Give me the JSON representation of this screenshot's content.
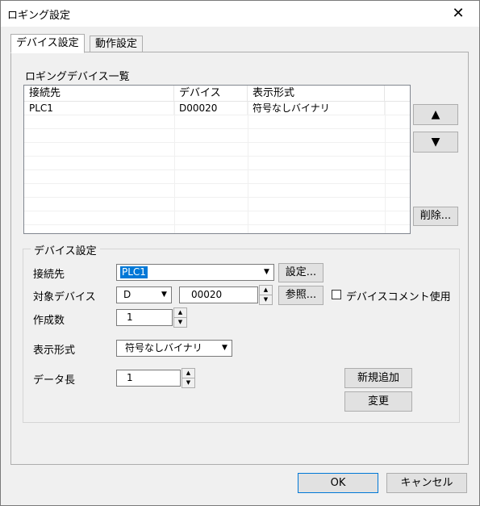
{
  "window": {
    "title": "ロギング設定",
    "close_glyph": "✕"
  },
  "tabs": [
    {
      "label": "デバイス設定",
      "active": true
    },
    {
      "label": "動作設定",
      "active": false
    }
  ],
  "device_list": {
    "title": "ロギングデバイス一覧",
    "columns": [
      "接続先",
      "デバイス",
      "表示形式"
    ],
    "rows": [
      {
        "connection": "PLC1",
        "device": "D00020",
        "format": "符号なしバイナリ"
      }
    ]
  },
  "list_buttons": {
    "up": "▲",
    "down": "▼",
    "delete": "削除..."
  },
  "device_settings": {
    "group_title": "デバイス設定",
    "connection_label": "接続先",
    "connection_value": "PLC1",
    "settings_button": "設定...",
    "target_device_label": "対象デバイス",
    "device_type_value": "D",
    "device_number_value": "00020",
    "browse_button": "参照...",
    "use_device_comment_label": "デバイスコメント使用",
    "use_device_comment_checked": false,
    "count_label": "作成数",
    "count_value": "1",
    "display_format_label": "表示形式",
    "display_format_value": "符号なしバイナリ",
    "data_length_label": "データ長",
    "data_length_value": "1",
    "add_button": "新規追加",
    "change_button": "変更"
  },
  "footer": {
    "ok": "OK",
    "cancel": "キャンセル"
  },
  "icons": {
    "dropdown": "▼",
    "spin_up": "▲",
    "spin_down": "▼"
  },
  "colors": {
    "selection": "#0078d7",
    "dialog_bg": "#f0f0f0"
  }
}
